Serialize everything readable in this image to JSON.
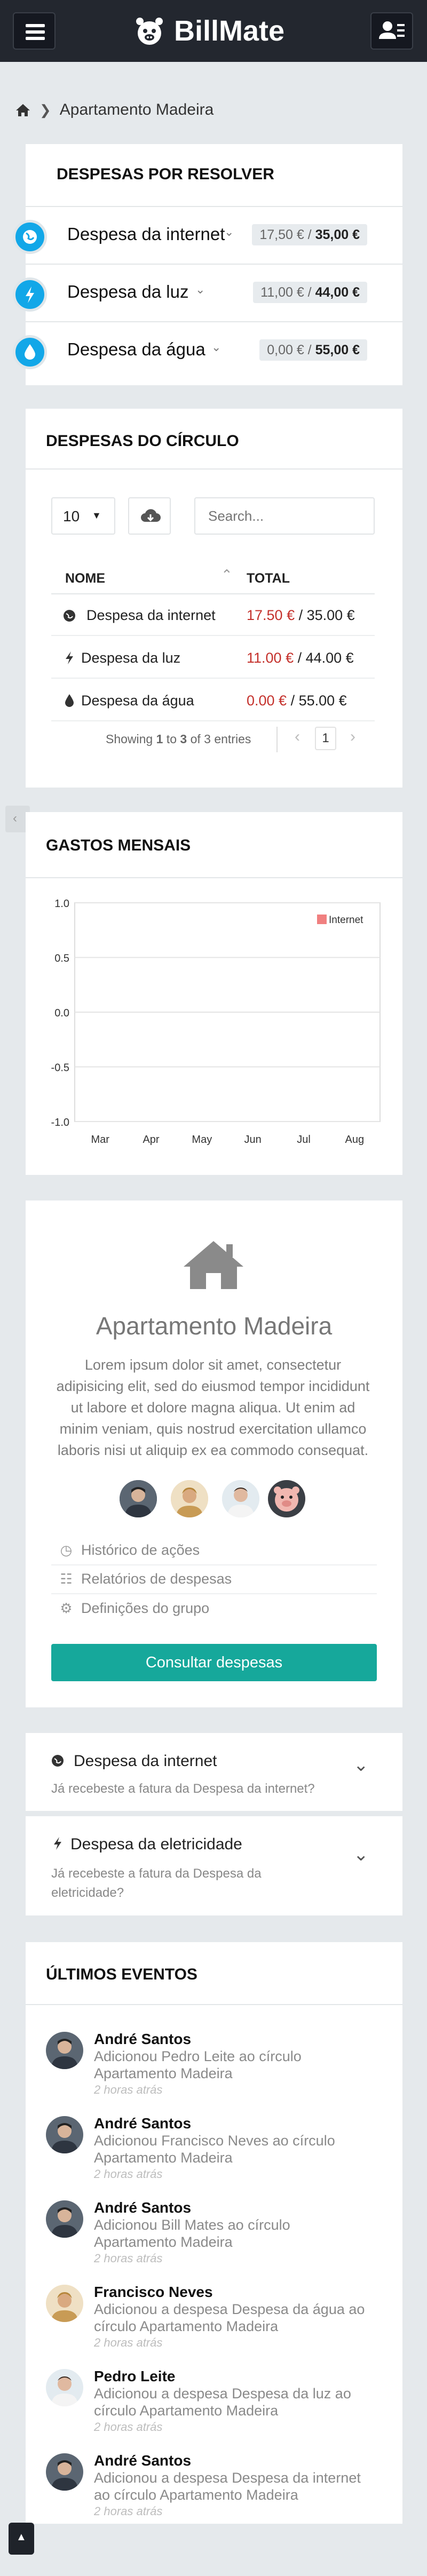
{
  "app": {
    "name": "BillMate"
  },
  "breadcrumb": {
    "current": "Apartamento Madeira"
  },
  "pending": {
    "title": "DESPESAS POR RESOLVER",
    "items": [
      {
        "icon": "globe-icon",
        "name": "Despesa da internet",
        "paid": "17,50 € / ",
        "total": "35,00 €"
      },
      {
        "icon": "bolt-icon",
        "name": "Despesa da luz",
        "paid": "11,00 € / ",
        "total": "44,00 €"
      },
      {
        "icon": "drop-icon",
        "name": "Despesa da água",
        "paid": "0,00 € / ",
        "total": "55,00 €"
      }
    ]
  },
  "circle": {
    "title": "DESPESAS DO CÍRCULO",
    "page_size": "10",
    "search_placeholder": "Search...",
    "columns": [
      "NOME",
      "TOTAL"
    ],
    "rows": [
      {
        "icon": "globe-icon",
        "name": "Despesa da internet",
        "paid": "17.50 €",
        "total": " / 35.00 €"
      },
      {
        "icon": "bolt-icon",
        "name": "Despesa da luz",
        "paid": "11.00 €",
        "total": " / 44.00 €"
      },
      {
        "icon": "drop-icon",
        "name": "Despesa da água",
        "paid": "0.00 €",
        "total": " / 55.00 €"
      }
    ],
    "info_prefix": "Showing ",
    "info_from": "1",
    "info_to_word": " to ",
    "info_to": "3",
    "info_suffix": " of 3 entries",
    "page": "1"
  },
  "monthly": {
    "title": "GASTOS MENSAIS"
  },
  "chart_data": {
    "type": "line",
    "categories": [
      "Mar",
      "Apr",
      "May",
      "Jun",
      "Jul",
      "Aug"
    ],
    "series": [
      {
        "name": "Internet",
        "color": "#f08080",
        "values": []
      }
    ],
    "yticks": [
      "1.0",
      "0.5",
      "0.0",
      "-0.5",
      "-1.0"
    ],
    "ylim": [
      -1,
      1
    ],
    "legend": "top-right",
    "grid": true
  },
  "group": {
    "name": "Apartamento Madeira",
    "description": "Lorem ipsum dolor sit amet, consectetur adipisicing elit, sed do eiusmod tempor incididunt ut labore et dolore magna aliqua. Ut enim ad minim veniam, quis nostrud exercitation ullamco laboris nisi ut aliquip ex ea commodo consequat.",
    "links": [
      {
        "icon": "clock-icon",
        "label": "Histórico de ações"
      },
      {
        "icon": "document-icon",
        "label": "Relatórios de despesas"
      },
      {
        "icon": "gear-icon",
        "label": "Definições do grupo"
      }
    ],
    "button": "Consultar despesas"
  },
  "questions": [
    {
      "icon": "globe-icon",
      "title": "Despesa da internet",
      "text": "Já recebeste a fatura da Despesa da internet?"
    },
    {
      "icon": "bolt-icon",
      "title": "Despesa da eletricidade",
      "text": "Já recebeste a fatura da Despesa da eletricidade?"
    }
  ],
  "events": {
    "title": "ÚLTIMOS EVENTOS",
    "items": [
      {
        "name": "André Santos",
        "desc": "Adicionou Pedro Leite ao círculo Apartamento Madeira",
        "time": "2 horas atrás"
      },
      {
        "name": "André Santos",
        "desc": "Adicionou Francisco Neves ao círculo Apartamento Madeira",
        "time": "2 horas atrás"
      },
      {
        "name": "André Santos",
        "desc": "Adicionou Bill Mates ao círculo Apartamento Madeira",
        "time": "2 horas atrás"
      },
      {
        "name": "Francisco Neves",
        "desc": "Adicionou a despesa Despesa da água ao círculo Apartamento Madeira",
        "time": "2 horas atrás"
      },
      {
        "name": "Pedro Leite",
        "desc": "Adicionou a despesa Despesa da luz ao círculo Apartamento Madeira",
        "time": "2 horas atrás"
      },
      {
        "name": "André Santos",
        "desc": "Adicionou a despesa Despesa da internet ao círculo Apartamento Madeira",
        "time": "2 horas atrás"
      }
    ]
  }
}
